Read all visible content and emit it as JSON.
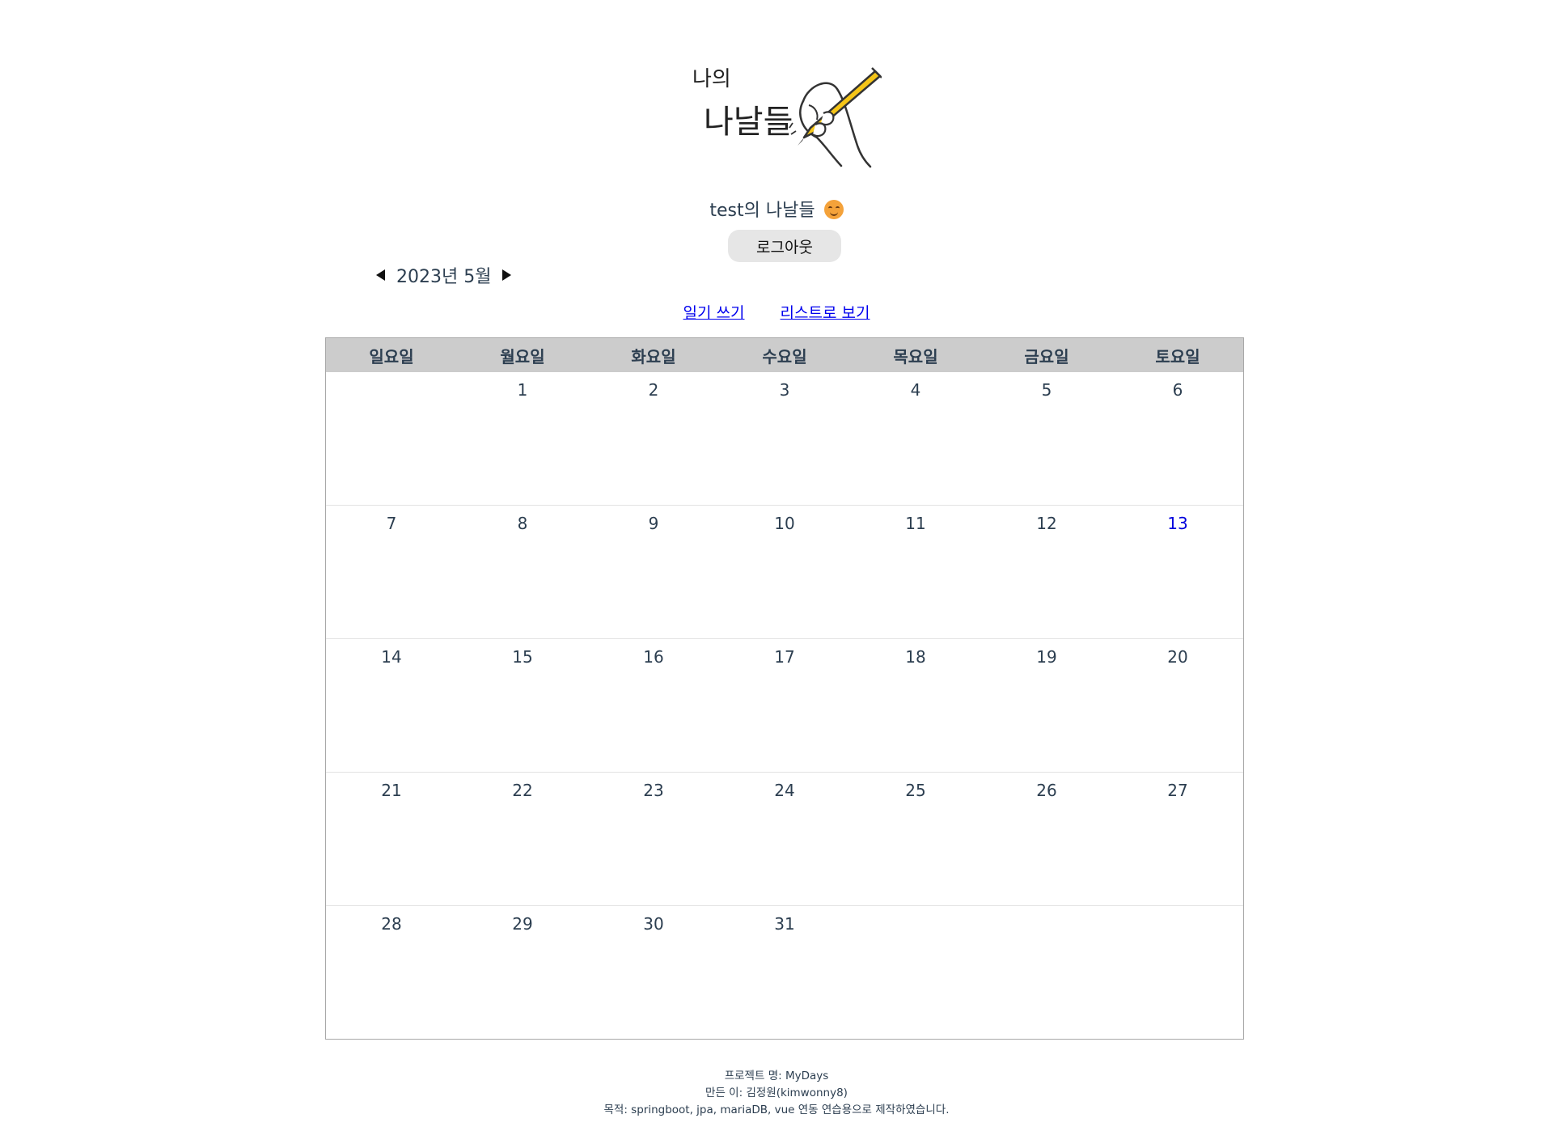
{
  "header": {
    "logo_line1": "나의",
    "logo_line2": "나날들",
    "greeting": "test의 나날들",
    "logout_label": "로그아웃"
  },
  "month_nav": {
    "label": "2023년 5월",
    "prev_icon": "triangle-left-icon",
    "next_icon": "triangle-right-icon"
  },
  "links": {
    "write": "일기 쓰기",
    "list": "리스트로 보기"
  },
  "calendar": {
    "weekdays": [
      "일요일",
      "월요일",
      "화요일",
      "수요일",
      "목요일",
      "금요일",
      "토요일"
    ],
    "weeks": [
      [
        "",
        "1",
        "2",
        "3",
        "4",
        "5",
        "6"
      ],
      [
        "7",
        "8",
        "9",
        "10",
        "11",
        "12",
        "13"
      ],
      [
        "14",
        "15",
        "16",
        "17",
        "18",
        "19",
        "20"
      ],
      [
        "21",
        "22",
        "23",
        "24",
        "25",
        "26",
        "27"
      ],
      [
        "28",
        "29",
        "30",
        "31",
        "",
        "",
        ""
      ]
    ],
    "today": "13",
    "header_bg": "#cccccc",
    "today_color": "#0000dd"
  },
  "footer": {
    "line1": "프로젝트 명: MyDays",
    "line2": "만든 이: 김정원(kimwonny8)",
    "line3": "목적: springboot, jpa, mariaDB, vue 연동 연습용으로 제작하였습니다."
  }
}
